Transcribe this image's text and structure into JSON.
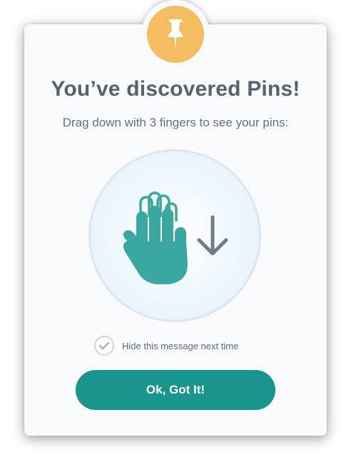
{
  "dialog": {
    "title": "You’ve discovered Pins!",
    "subtitle": "Drag down with 3 fingers to see your pins:",
    "badge_icon": "pushpin-icon",
    "illustration_icons": [
      "three-finger-hand-icon",
      "arrow-down-icon"
    ],
    "checkbox": {
      "label": "Hide this message next time",
      "checked": true
    },
    "ok_button_label": "Ok, Got It!"
  },
  "colors": {
    "badge": "#f4bd62",
    "title": "#556270",
    "hand": "#3aa7a1",
    "arrow": "#6f7c89",
    "button": "#1a958d",
    "card": "#f9fafd"
  }
}
